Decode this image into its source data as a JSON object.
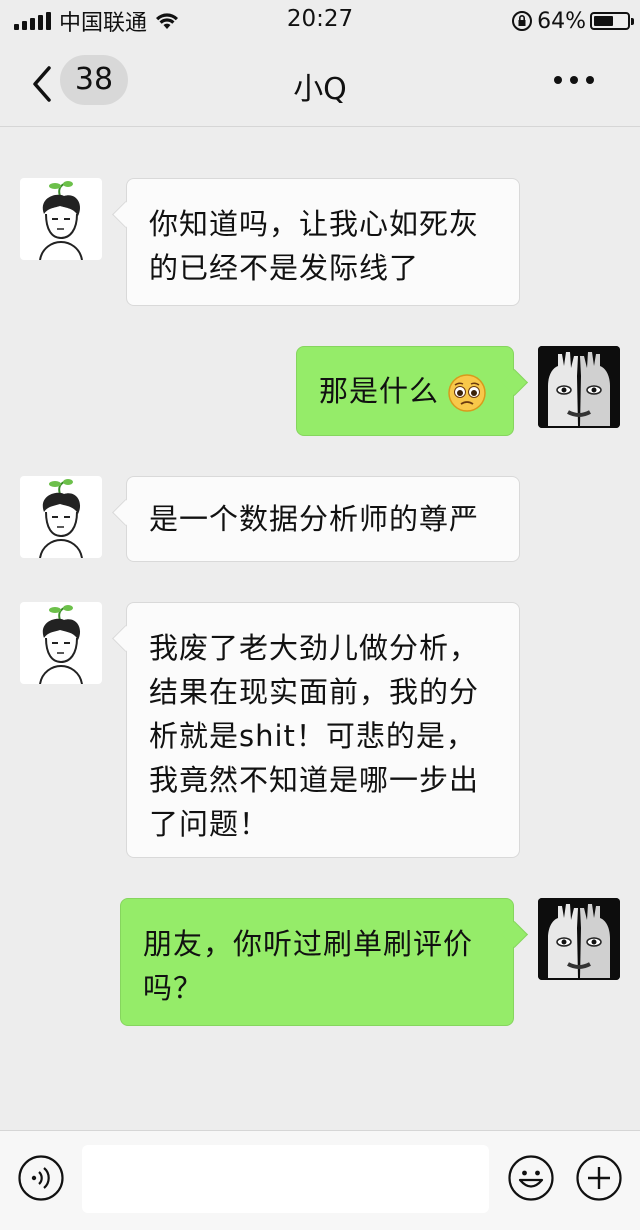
{
  "status_bar": {
    "carrier": "中国联通",
    "time": "20:27",
    "battery_percent": "64%",
    "battery_level": 0.64
  },
  "nav": {
    "back_icon": "chevron-left-icon",
    "unread_count": "38",
    "title": "小Q",
    "more_icon": "more-dots-icon"
  },
  "messages": [
    {
      "side": "in",
      "text": "你知道吗，让我心如死灰的已经不是发际线了"
    },
    {
      "side": "out",
      "text": "那是什么",
      "emoji": "pleading-face-emoji"
    },
    {
      "side": "in",
      "text": "是一个数据分析师的尊严"
    },
    {
      "side": "in",
      "text": "我废了老大劲儿做分析，结果在现实面前，我的分析就是shit！可悲的是，我竟然不知道是哪一步出了问题！"
    },
    {
      "side": "out",
      "text": "朋友，你听过刷单刷评价吗？"
    }
  ],
  "input_bar": {
    "voice_icon": "voice-icon",
    "text_value": "",
    "emoji_icon": "emoji-icon",
    "plus_icon": "plus-icon"
  },
  "colors": {
    "background": "#ededed",
    "outgoing_bubble": "#95ec69",
    "incoming_bubble": "#fbfbfb"
  }
}
